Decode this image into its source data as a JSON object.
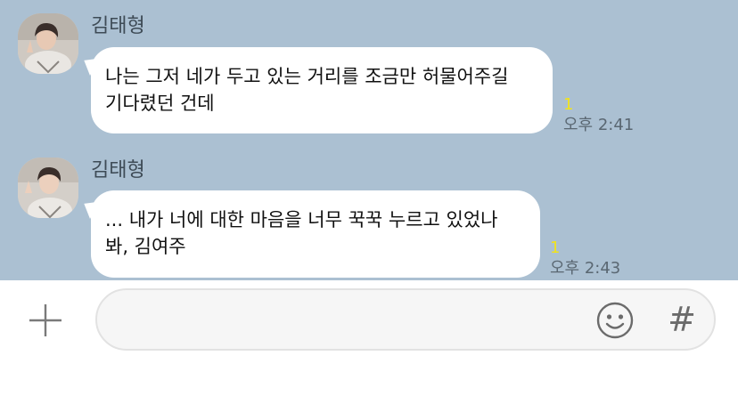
{
  "chat": {
    "messages": [
      {
        "sender": "김태형",
        "lines": [
          "나는 그저 네가 두고 있는 거리를 조금만 허물어주길",
          "기다렸던 건데"
        ],
        "unread": "1",
        "time": "오후 2:41",
        "avatar_icon": "profile-photo"
      },
      {
        "sender": "김태형",
        "lines": [
          "... 내가 너에 대한 마음을 너무 꾹꾹 누르고 있었나",
          "봐, 김여주"
        ],
        "unread": "1",
        "time": "오후 2:43",
        "avatar_icon": "profile-photo"
      }
    ]
  },
  "composer": {
    "input_value": "",
    "input_placeholder": "",
    "plus_icon": "plus-icon",
    "emoji_icon": "smiley-icon",
    "hash_label": "#"
  },
  "colors": {
    "chat_background": "#abc0d2",
    "bubble": "#ffffff",
    "unread": "#f2e31a",
    "time": "#5a6772"
  }
}
